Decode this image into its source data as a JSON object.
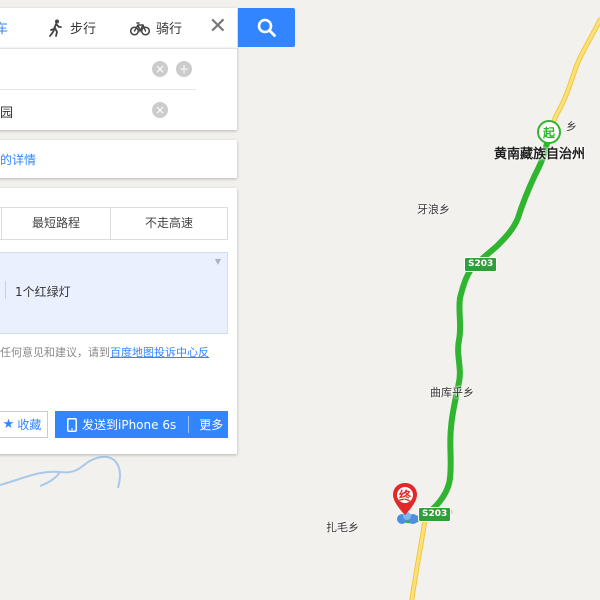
{
  "transport_tabs": {
    "drive": "驾车",
    "walk": "步行",
    "bike": "骑行"
  },
  "route_inputs": {
    "end_value": "园"
  },
  "details_link": "的详情",
  "route_prefs": {
    "shortest": "最短路程",
    "no_highway": "不走高速"
  },
  "route_summary": {
    "traffic_lights": "1个红绿灯"
  },
  "feedback": {
    "text_prefix": "任何意见和建议，请到",
    "link": "百度地图投诉中心反"
  },
  "actions": {
    "favorite": "收藏",
    "send_to_phone": "发送到iPhone 6s",
    "more": "更多"
  },
  "map": {
    "place_labels": {
      "prefecture": "黄南藏族自治州",
      "town_north_partial": "乡",
      "yalang": "牙浪乡",
      "qukuhu": "曲库乎乡",
      "zhamao": "扎毛乡"
    },
    "road_shields": [
      "S203",
      "S203"
    ],
    "markers": {
      "start": "起",
      "end": "终"
    },
    "colors": {
      "route": "#36c236",
      "road": "#f7d35a",
      "river": "#a8c9ea",
      "accent": "#3385ff"
    }
  }
}
